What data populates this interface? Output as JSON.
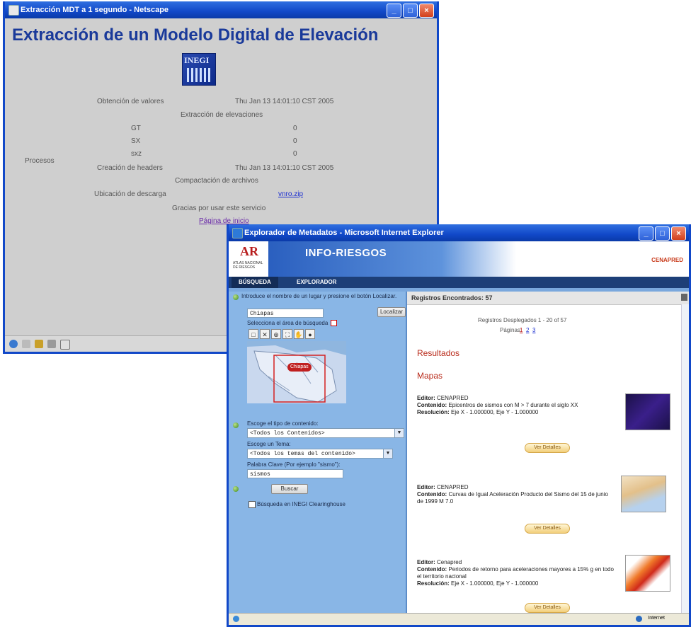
{
  "netscape": {
    "title": "Extracción MDT a 1 segundo - Netscape",
    "heading": "Extracción de un Modelo Digital de Elevación",
    "logo_text": "INEGI",
    "process_label": "Procesos",
    "rows": {
      "obtencion_label": "Obtención de valores",
      "obtencion_time": "Thu Jan 13 14:01:10 CST 2005",
      "extraccion": "Extracción de elevaciones",
      "gt_label": "GT",
      "gt_value": "0",
      "sx_label": "SX",
      "sx_value": "0",
      "sxz_label": "sxz",
      "sxz_value": "0",
      "creacion_label": "Creación de headers",
      "creacion_time": "Thu Jan 13 14:01:10 CST 2005",
      "compactacion": "Compactación de archivos",
      "ubicacion_label": "Ubicación de descarga",
      "ubicacion_link": "vnro.zip",
      "gracias": "Gracias por usar este servicio",
      "pagina_inicio": "Página de inicio"
    }
  },
  "ie": {
    "title": "Explorador de Metadatos - Microsoft Internet Explorer",
    "brand": "INFO-RIESGOS",
    "logo": "AR",
    "logo_sub": "ATLAS NACIONAL DE RIESGOS",
    "partner": "CENAPRED",
    "tabs": [
      "BÚSQUEDA",
      "EXPLORADOR"
    ],
    "search": {
      "step1": "Introduce el nombre de un lugar y presione el botón Localizar.",
      "place_value": "Chiapas",
      "locate_btn": "Localizar",
      "step2": "Selecciona el área de búsqueda",
      "map_label": "Chiapas",
      "step3": "Escoge el tipo de contenido:",
      "content_value": "<Todos los Contenidos>",
      "theme_label": "Escoge un Tema:",
      "theme_value": "<Todos los temas del contenido>",
      "keyword_label": "Palabra Clave (Por ejemplo \"sismo\"):",
      "keyword_value": "sismos",
      "search_btn": "Buscar",
      "checkbox_label": "Búsqueda en INEGI Clearinghouse"
    },
    "results": {
      "header": "Registros Encontrados: 57",
      "displayed": "Registros Desplegados 1 - 20 of 57",
      "pages_label": "Páginas:",
      "pages": [
        "1",
        "2",
        "3"
      ],
      "resultados": "Resultados",
      "mapas": "Mapas",
      "editor_label": "Editor:",
      "contenido_label": "Contenido:",
      "resolucion_label": "Resolución:",
      "items": [
        {
          "editor": "CENAPRED",
          "contenido": "Epicentros de sismos con M > 7 durante el siglo XX",
          "resolucion": "Eje X - 1.000000, Eje Y - 1.000000"
        },
        {
          "editor": "CENAPRED",
          "contenido": "Curvas de Igual Aceleración Producto del Sismo del 15 de junio de 1999 M 7.0",
          "resolucion": ""
        },
        {
          "editor": "Cenapred",
          "contenido": "Periodos de retorno para aceleraciones mayores a 15% g en todo el territorio nacional",
          "resolucion": "Eje X - 1.000000, Eje Y - 1.000000"
        }
      ],
      "details_btn": "Ver Detalles"
    },
    "status_zone": "Internet"
  }
}
